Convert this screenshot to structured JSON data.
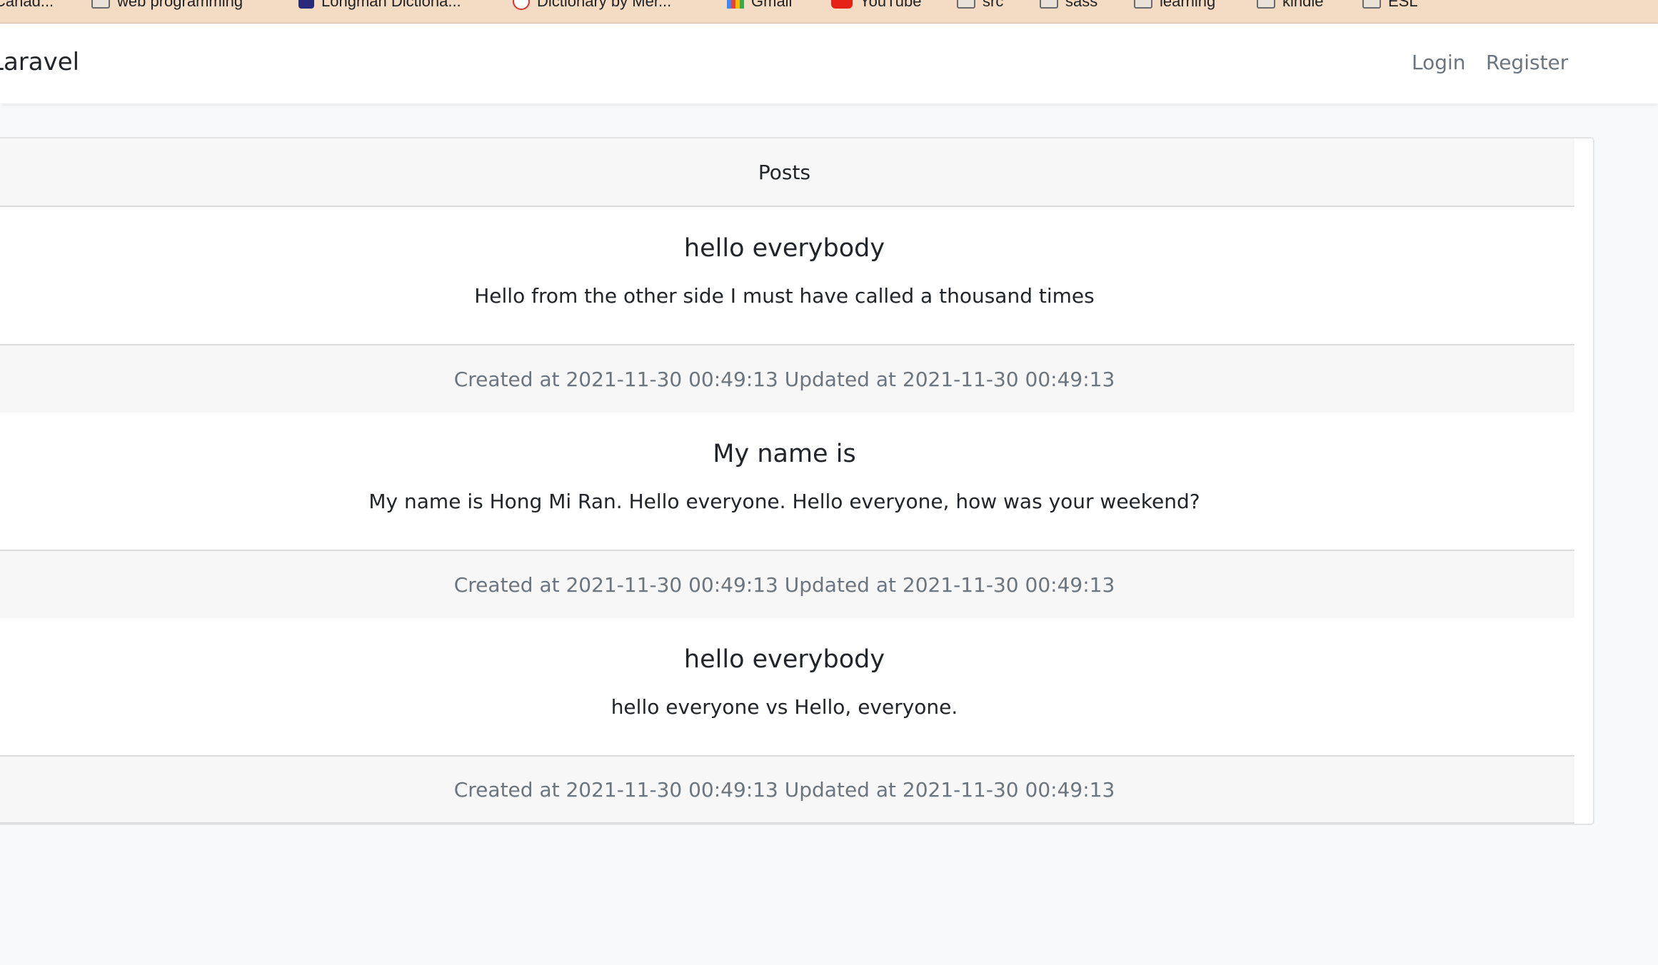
{
  "bookmarks": [
    {
      "label": "Canad...",
      "icon": "page-icon"
    },
    {
      "label": "web programming",
      "icon": "folder-icon"
    },
    {
      "label": "Longman Dictiona...",
      "icon": "longman-icon"
    },
    {
      "label": "Dictionary by Mer...",
      "icon": "dictionary-icon"
    },
    {
      "label": "Gmail",
      "icon": "gmail-icon"
    },
    {
      "label": "YouTube",
      "icon": "youtube-icon"
    },
    {
      "label": "src",
      "icon": "folder-icon"
    },
    {
      "label": "sass",
      "icon": "folder-icon"
    },
    {
      "label": "learning",
      "icon": "folder-icon"
    },
    {
      "label": "kindle",
      "icon": "folder-icon"
    },
    {
      "label": "ESL",
      "icon": "folder-icon"
    }
  ],
  "navbar": {
    "brand": "Laravel",
    "login_label": "Login",
    "register_label": "Register"
  },
  "card": {
    "header": "Posts"
  },
  "posts": [
    {
      "title": "hello everybody",
      "body": "Hello from the other side I must have called a thousand times",
      "footer": "Created at 2021-11-30 00:49:13 Updated at 2021-11-30 00:49:13"
    },
    {
      "title": "My name is",
      "body": "My name is Hong Mi Ran. Hello everyone. Hello everyone, how was your weekend?",
      "footer": "Created at 2021-11-30 00:49:13 Updated at 2021-11-30 00:49:13"
    },
    {
      "title": "hello everybody",
      "body": "hello everyone vs Hello, everyone.",
      "footer": "Created at 2021-11-30 00:49:13 Updated at 2021-11-30 00:49:13"
    }
  ],
  "colors": {
    "bookmarks_bar": "#f4dcc4",
    "page_background": "#f8f9fb",
    "muted_text": "#6c757d",
    "card_section_bg": "#f7f7f7"
  }
}
